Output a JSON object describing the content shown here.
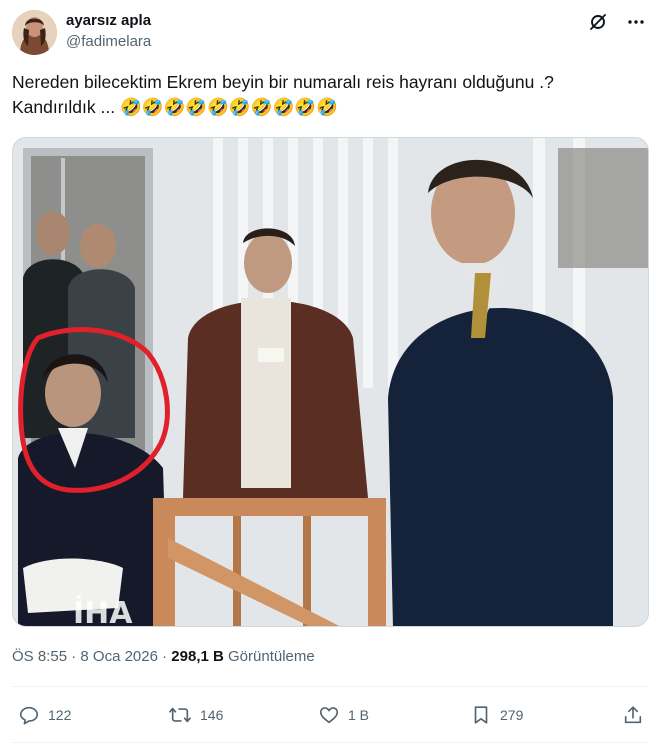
{
  "author": {
    "display_name": "ayarsız apla",
    "handle": "@fadimelara",
    "avatar_icon": "profile-photo-icon"
  },
  "header_icons": [
    "grok-icon",
    "more-icon"
  ],
  "tweet": {
    "text_line1": "Nereden bilecektim Ekrem beyin bir numaralı reis hayranı olduğunu .?",
    "text_line2": "Kandırıldık ... 🤣🤣🤣🤣🤣🤣🤣🤣🤣🤣"
  },
  "media": {
    "watermark": "İHA",
    "highlight_color": "#e0202a"
  },
  "meta": {
    "time": "ÖS 8:55",
    "separator": "·",
    "date": "8 Oca 2026",
    "views_count": "298,1 B",
    "views_label": "Görüntüleme"
  },
  "actions": {
    "reply_count": "122",
    "retweet_count": "146",
    "like_count": "1 B",
    "bookmark_count": "279"
  },
  "colors": {
    "text_primary": "#0f1419",
    "text_secondary": "#536471",
    "divider": "#eff3f4"
  }
}
